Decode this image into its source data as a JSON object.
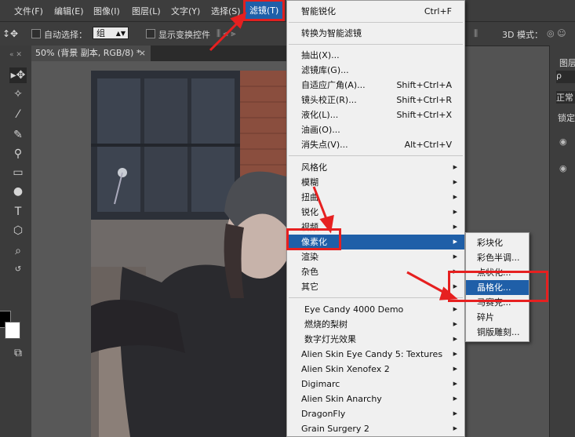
{
  "menubar": {
    "items": [
      "文件(F)",
      "编辑(E)",
      "图像(I)",
      "图层(L)",
      "文字(Y)",
      "选择(S)",
      "滤镜(T)"
    ]
  },
  "options": {
    "auto_select_label": "自动选择：",
    "auto_select_value": "组",
    "show_transform_label": "显示变换控件",
    "mode_3d_label": "3D 模式："
  },
  "document": {
    "tab_title": "50% (背景 副本, RGB/8) *",
    "close_glyph": "×"
  },
  "right_panel": {
    "layers_label": "图层",
    "search_glyph": "ρ",
    "blend_mode": "正常",
    "lock_label": "锁定"
  },
  "filter_menu": {
    "items": [
      {
        "label": "智能锐化",
        "shortcut": "Ctrl+F"
      },
      {
        "label": "转换为智能滤镜",
        "shortcut": ""
      },
      {
        "label": "抽出(X)...",
        "shortcut": ""
      },
      {
        "label": "滤镜库(G)...",
        "shortcut": ""
      },
      {
        "label": "自适应广角(A)...",
        "shortcut": "Shift+Ctrl+A"
      },
      {
        "label": "镜头校正(R)...",
        "shortcut": "Shift+Ctrl+R"
      },
      {
        "label": "液化(L)...",
        "shortcut": "Shift+Ctrl+X"
      },
      {
        "label": "油画(O)...",
        "shortcut": ""
      },
      {
        "label": "消失点(V)...",
        "shortcut": "Alt+Ctrl+V"
      },
      {
        "label": "风格化",
        "shortcut": ""
      },
      {
        "label": "模糊",
        "shortcut": ""
      },
      {
        "label": "扭曲",
        "shortcut": ""
      },
      {
        "label": "锐化",
        "shortcut": ""
      },
      {
        "label": "视频",
        "shortcut": ""
      },
      {
        "label": "像素化",
        "shortcut": ""
      },
      {
        "label": "渲染",
        "shortcut": ""
      },
      {
        "label": "杂色",
        "shortcut": ""
      },
      {
        "label": "其它",
        "shortcut": ""
      },
      {
        "label": "Eye Candy 4000 Demo",
        "shortcut": ""
      },
      {
        "label": "燃烧的梨树",
        "shortcut": ""
      },
      {
        "label": "数字灯光效果",
        "shortcut": ""
      },
      {
        "label": "Alien Skin Eye Candy 5: Textures",
        "shortcut": ""
      },
      {
        "label": "Alien Skin Xenofex 2",
        "shortcut": ""
      },
      {
        "label": "Digimarc",
        "shortcut": ""
      },
      {
        "label": "Alien Skin Anarchy",
        "shortcut": ""
      },
      {
        "label": "DragonFly",
        "shortcut": ""
      },
      {
        "label": "Grain Surgery 2",
        "shortcut": ""
      }
    ]
  },
  "pixelate_submenu": {
    "items": [
      "彩块化",
      "彩色半调...",
      "点状化...",
      "晶格化...",
      "马赛克...",
      "碎片",
      "铜版雕刻..."
    ]
  },
  "colors": {
    "highlight": "#1f5fa8",
    "annotation_red": "#e62020"
  }
}
